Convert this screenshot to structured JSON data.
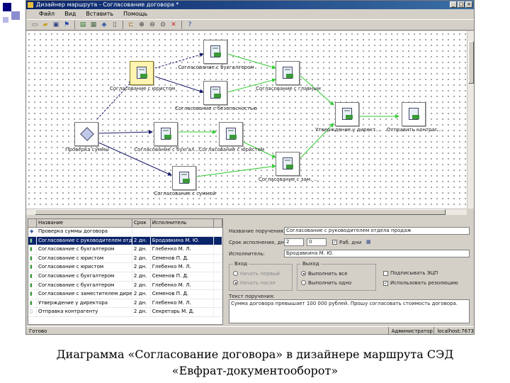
{
  "colors": {
    "accent_square": "#000080",
    "arrow_blue": "#1a1a6e",
    "arrow_green": "#33cc33",
    "selection": "#0a246a"
  },
  "window": {
    "title": "Дизайнер маршрута - Согласование договора *",
    "menu": [
      "Файл",
      "Вид",
      "Вставить",
      "Помощь"
    ]
  },
  "toolbar_icons": [
    "new-icon",
    "open-icon",
    "save-icon",
    "flag-icon",
    "sep",
    "print-icon",
    "form-icon",
    "diamond-icon",
    "document-icon",
    "sep",
    "branch-icon",
    "zoom-in-icon",
    "zoom-out-icon",
    "zoom-icon",
    "delete-icon",
    "sep",
    "help-icon"
  ],
  "diagram": {
    "nodes": [
      {
        "id": "start",
        "label": "Проверка суммы",
        "icon": "diamond",
        "selected": false
      },
      {
        "id": "lawyer",
        "label": "Согласование с юристом",
        "icon": "document",
        "selected": true
      },
      {
        "id": "accountant1",
        "label": "Согласование с бухгалтером",
        "icon": "document",
        "selected": false
      },
      {
        "id": "security",
        "label": "Согласование с безопасностью",
        "icon": "document",
        "selected": false
      },
      {
        "id": "chief",
        "label": "Согласование с главным",
        "icon": "document",
        "selected": false
      },
      {
        "id": "buh",
        "label": "Согласование с бухгал...",
        "icon": "document",
        "selected": false
      },
      {
        "id": "urist2",
        "label": "Согласование с юристом",
        "icon": "document",
        "selected": false
      },
      {
        "id": "head",
        "label": "Согласование с зам. ...",
        "icon": "document",
        "selected": false
      },
      {
        "id": "director",
        "label": "Утверждение у директ...",
        "icon": "document",
        "selected": false
      },
      {
        "id": "send",
        "label": "Отправить контраг...",
        "icon": "document",
        "selected": false
      },
      {
        "id": "sum",
        "label": "Согласование с суммой",
        "icon": "document",
        "selected": false
      }
    ]
  },
  "steps_table": {
    "headers": [
      "",
      "Название",
      "Срок",
      "Исполнитель",
      ""
    ],
    "rows": [
      {
        "name": "Проверка суммы договора",
        "term": "",
        "executor": "",
        "selected": false
      },
      {
        "name": "Согласование с руководителем отдел...",
        "term": "2 дн.",
        "executor": "Бродавкина М. Ю.",
        "selected": true
      },
      {
        "name": "Согласование с бухгалтером",
        "term": "2 дн.",
        "executor": "Глебенко М. Л.",
        "selected": false
      },
      {
        "name": "Согласование с юристом",
        "term": "2 дн.",
        "executor": "Семенов П. Д.",
        "selected": false
      },
      {
        "name": "Согласование с юристом",
        "term": "2 дн.",
        "executor": "Глебенко М. Л.",
        "selected": false
      },
      {
        "name": "Согласование с бухгалтером",
        "term": "2 дн.",
        "executor": "Семенов П. Д.",
        "selected": false
      },
      {
        "name": "Согласование с бухгалтером",
        "term": "2 дн.",
        "executor": "Глебенко М. Л.",
        "selected": false
      },
      {
        "name": "Согласование с заместителем директора",
        "term": "2 дн.",
        "executor": "Семенов П. Д.",
        "selected": false
      },
      {
        "name": "Утверждение у директора",
        "term": "2 дн.",
        "executor": "Глебенко М. Л.",
        "selected": false
      },
      {
        "name": "Отправка контрагенту",
        "term": "2 дн.",
        "executor": "Секретарь М. Д.",
        "selected": false
      }
    ]
  },
  "properties": {
    "name_label": "Название поручения:",
    "name_value": "Согласование с руководителем отдела продаж",
    "term_label": "Срок исполнения, дн:",
    "term_value": "2",
    "term_value2": "0",
    "work_days_label": "Раб. дни",
    "executor_label": "Исполнитель:",
    "executor_value": "Бродавкина М. Ю.",
    "enter_group": "Вход",
    "enter_opt1": "Начать первый",
    "enter_opt2": "Начать после",
    "exit_group": "Выход",
    "exit_opt1": "Выполнить все",
    "exit_opt2": "Выполнить одно",
    "check_ecp": "Подписывать ЭЦП",
    "check_resolution": "Использовать резолюцию",
    "text_label": "Текст поручения:",
    "text_value": "Сумма договора превышает 100 000 рублей. Прошу согласовать стоимость договора."
  },
  "statusbar": {
    "left": "Готово",
    "user": "Администратор",
    "host": "localhost:7673"
  },
  "caption": {
    "line1": "Диаграмма «Согласование договора» в дизайнере маршрута СЭД",
    "line2": "«Евфрат-документооборот»"
  }
}
